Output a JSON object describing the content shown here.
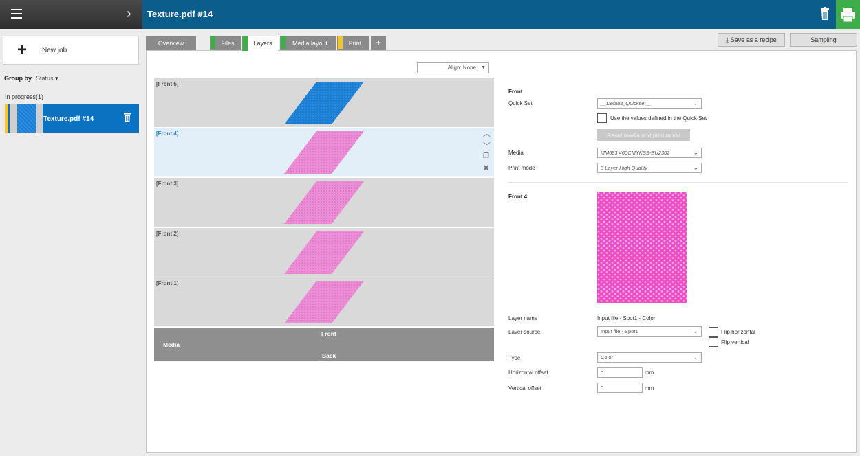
{
  "header": {
    "title": "Texture.pdf #14"
  },
  "sidebar": {
    "new_job_label": "New job",
    "group_by_label": "Group by",
    "group_by_value": "Status",
    "section_label": "In progress(1)",
    "jobs": [
      {
        "name": "Texture.pdf #14"
      }
    ]
  },
  "tabs": [
    {
      "label": "Overview",
      "active": false
    },
    {
      "label": "Files",
      "active": false,
      "marker_color": "#3fae49"
    },
    {
      "label": "Layers",
      "active": true,
      "marker_color": "#3fae49"
    },
    {
      "label": "Media layout",
      "active": false,
      "marker_color": "#3fae49"
    },
    {
      "label": "Print",
      "active": false,
      "marker_color": "#f3c530"
    },
    {
      "label": "+",
      "active": false
    }
  ],
  "actions": {
    "save_recipe_label": "Save as a recipe",
    "sampling_label": "Sampling"
  },
  "layers_panel": {
    "align_value": "Align: None",
    "layers": [
      {
        "name": "[Front 5]",
        "color": "#1a7fd4",
        "selected": false
      },
      {
        "name": "[Front 4]",
        "color": "#ec8fd6",
        "selected": true
      },
      {
        "name": "[Front 3]",
        "color": "#ec8fd6",
        "selected": false
      },
      {
        "name": "[Front 2]",
        "color": "#ec8fd6",
        "selected": false
      },
      {
        "name": "[Front 1]",
        "color": "#ec8fd6",
        "selected": false
      }
    ],
    "media_label": "Media",
    "media_front_label": "Front",
    "media_back_label": "Back"
  },
  "settings": {
    "section_front": "Front",
    "quick_set_label": "Quick Set",
    "quick_set_value": "__Default_Quickset__",
    "use_values_label": "Use the values defined in the Quick Set",
    "reset_label": "Reset media and print mode",
    "media_label": "Media",
    "media_value": "IJM683 460CMYKSS-EU2302",
    "print_mode_label": "Print mode",
    "print_mode_value": "3 Layer High Quality",
    "layer_section": "Front 4",
    "layer_name_label": "Layer name",
    "layer_name_value": "Input file - Spot1 - Color",
    "layer_source_label": "Layer source",
    "layer_source_value": "Input file - Spot1",
    "flip_horizontal_label": "Flip horizontal",
    "flip_vertical_label": "Flip vertical",
    "type_label": "Type",
    "type_value": "Color",
    "h_offset_label": "Horizontal offset",
    "h_offset_value": "0",
    "v_offset_label": "Vertical offset",
    "v_offset_value": "0",
    "unit": "mm"
  },
  "colors": {
    "header_blue": "#0b5d8b",
    "print_green": "#3fae49",
    "selected_blue": "#0a72c0",
    "texture_pink": "#ec8fd6"
  }
}
